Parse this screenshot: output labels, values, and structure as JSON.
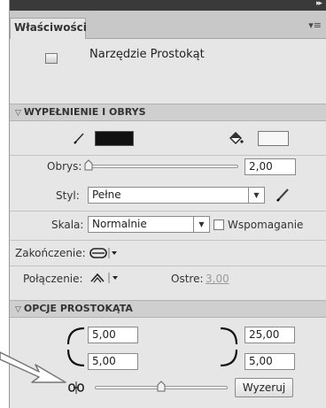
{
  "panel": {
    "tab_label": "Właściwości",
    "panel_menu": "▾≡",
    "collapse_glyph": "▸▸"
  },
  "tool": {
    "name": "Narzędzie Prostokąt",
    "icon": "rectangle-tool-icon"
  },
  "fill_stroke": {
    "section_title": "WYPEŁNIENIE I OBRYS",
    "stroke_color": "#111111",
    "fill_color": "#f7f7f7",
    "obrys_label": "Obrys:",
    "obrys_value": "2,00",
    "obrys_slider_level": 0.0,
    "styl_label": "Styl:",
    "styl_value": "Pełne",
    "skala_label": "Skala:",
    "skala_value": "Normalnie",
    "hinting_label": "Wspomaganie",
    "hinting_checked": false,
    "cap_label": "Zakończenie:",
    "join_label": "Połączenie:",
    "miter_label": "Ostre:",
    "miter_value": "3,00"
  },
  "rect_options": {
    "section_title": "OPCJE PROSTOKĄTA",
    "top_left": "5,00",
    "top_right": "25,00",
    "bottom_left": "5,00",
    "bottom_right": "5,00",
    "corner_slider_level": 0.5,
    "reset_label": "Wyzeruj"
  }
}
